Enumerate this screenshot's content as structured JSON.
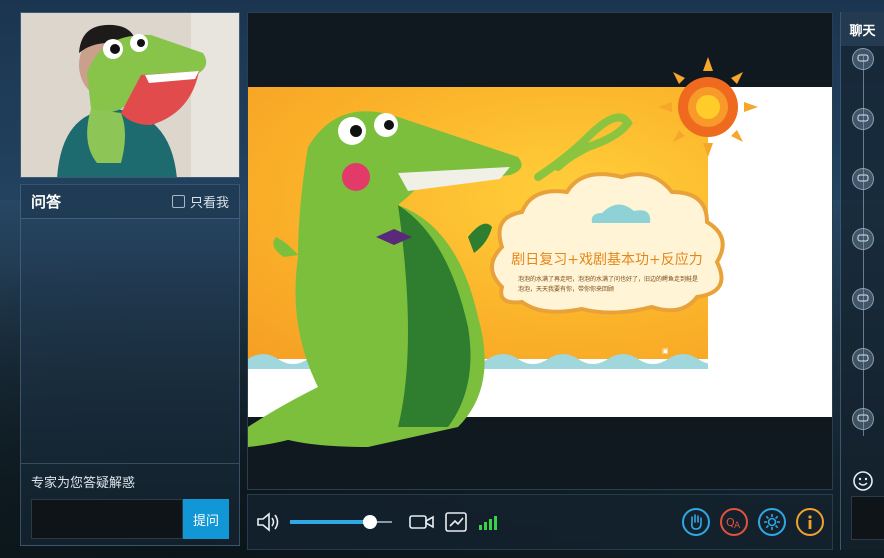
{
  "qa": {
    "title": "问答",
    "only_me_label": "只看我",
    "hint": "专家为您答疑解惑",
    "input_value": "",
    "submit_label": "提问"
  },
  "slide": {
    "title": "剧日复习+戏剧基本功+反应力",
    "body": "泡泡的水满了再走吧，泡泡的水满了问也好了，旧边的鳄鱼走到鲑是泡泡，天天我要有你，带你你来回顾"
  },
  "controls": {
    "volume_fraction": 0.78,
    "icons": [
      "speaker-icon",
      "camera-icon",
      "screen-share-icon",
      "signal-icon",
      "raise-hand-icon",
      "qa-icon",
      "settings-icon",
      "info-icon"
    ],
    "accent_color": "#2fa8e4",
    "signal_color": "#3ad04a"
  },
  "chat": {
    "title": "聊天"
  }
}
